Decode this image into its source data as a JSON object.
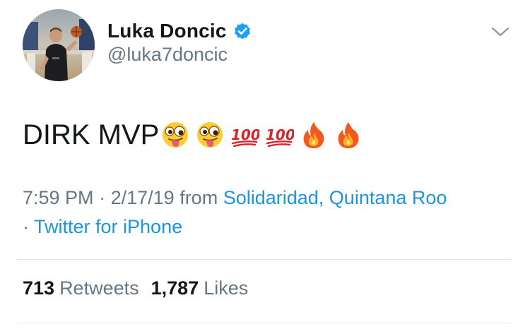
{
  "user": {
    "display_name": "Luka Doncic",
    "handle": "@luka7doncic",
    "verified": true,
    "avatar_icon": "profile-photo"
  },
  "tweet": {
    "text": "DIRK MVP",
    "emojis": [
      "winking-face-with-tongue",
      "winking-face-with-tongue",
      "hundred-points",
      "hundred-points",
      "fire",
      "fire"
    ]
  },
  "meta": {
    "time": "7:59 PM",
    "date": "2/17/19",
    "from_label": "from",
    "location": "Solidaridad, Quintana Roo",
    "source": "Twitter for iPhone"
  },
  "stats": {
    "retweets_count": "713",
    "retweets_label": "Retweets",
    "likes_count": "1,787",
    "likes_label": "Likes"
  },
  "colors": {
    "text": "#14171a",
    "secondary": "#657786",
    "link": "#1b95e0",
    "verified": "#1da1f2",
    "divider": "#e1e8ed"
  }
}
